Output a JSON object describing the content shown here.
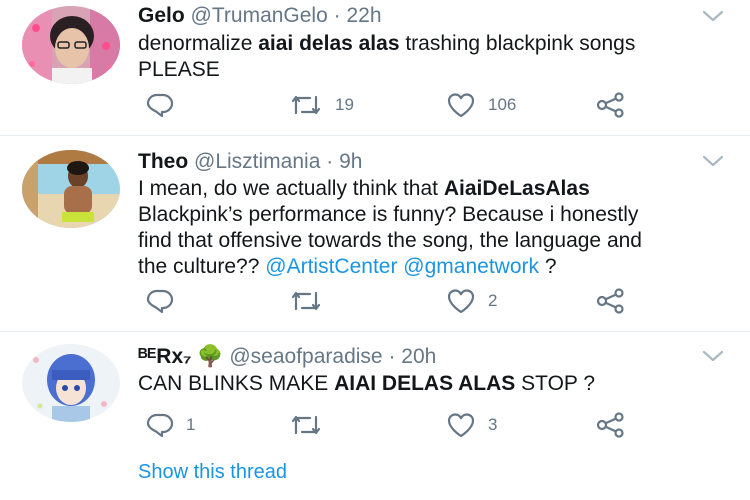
{
  "tweets": [
    {
      "name": "Gelo",
      "handle": "@TrumanGelo",
      "sep": "·",
      "time": "22h",
      "body": [
        {
          "t": "denormalize ",
          "style": "normal"
        },
        {
          "t": "aiai delas alas",
          "style": "bold"
        },
        {
          "t": " trashing blackpink songs\nPLEASE",
          "style": "normal"
        }
      ],
      "replies": "",
      "retweets": "19",
      "likes": "106"
    },
    {
      "name": "Theo",
      "handle": "@Lisztimania",
      "sep": "·",
      "time": "9h",
      "body": [
        {
          "t": "I mean, do we actually think that ",
          "style": "normal"
        },
        {
          "t": "AiaiDeLasAlas",
          "style": "bold"
        },
        {
          "t": "\nBlackpink’s performance is funny? Because i honestly\nfind that offensive towards the song, the language and\nthe culture?? ",
          "style": "normal"
        },
        {
          "t": "@ArtistCenter",
          "style": "link"
        },
        {
          "t": " ",
          "style": "normal"
        },
        {
          "t": "@gmanetwork",
          "style": "link"
        },
        {
          "t": " ?",
          "style": "normal"
        }
      ],
      "replies": "",
      "retweets": "",
      "likes": "2"
    },
    {
      "name": "ᴮᴱRx₇ 🌳",
      "handle": "@seaofparadise",
      "sep": "·",
      "time": "20h",
      "body": [
        {
          "t": "CAN BLINKS MAKE ",
          "style": "normal"
        },
        {
          "t": "AIAI DELAS ALAS",
          "style": "bold"
        },
        {
          "t": " STOP ?",
          "style": "normal"
        }
      ],
      "replies": "1",
      "retweets": "",
      "likes": "3"
    }
  ],
  "thread_link": "Show this thread",
  "colors": {
    "accent": "#1b95e0",
    "muted": "#657786",
    "text": "#14171a",
    "divider": "#e6ecf0"
  },
  "icons": [
    "reply-icon",
    "retweet-icon",
    "like-icon",
    "share-icon",
    "chevron-down-icon"
  ]
}
